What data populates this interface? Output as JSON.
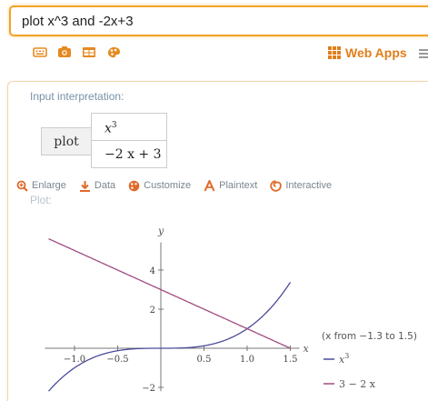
{
  "search": {
    "query": "plot x^3 and -2x+3"
  },
  "toolbar": {
    "icons": [
      "keyboard-icon",
      "camera-icon",
      "table-icon",
      "palette-icon"
    ],
    "web_apps_label": "Web Apps"
  },
  "interpretation": {
    "title": "Input interpretation:",
    "command": "plot",
    "f1_base": "x",
    "f1_exp": "3",
    "f2": "−2 x + 3"
  },
  "actions": {
    "enlarge": "Enlarge",
    "data": "Data",
    "customize": "Customize",
    "plaintext": "Plaintext",
    "interactive": "Interactive"
  },
  "plot_pod": {
    "title": "Plot:"
  },
  "colors": {
    "accent": "#f2a427",
    "series1": "#4b4b9c",
    "series2": "#a04a7f"
  },
  "chart_data": {
    "type": "line",
    "title": "",
    "xlabel": "x",
    "ylabel": "y",
    "xlim": [
      -1.3,
      1.5
    ],
    "ylim": [
      -2.2,
      5.6
    ],
    "x_ticks": [
      -1.0,
      -0.5,
      0.5,
      1.0,
      1.5
    ],
    "x_tick_labels": [
      "−1.0",
      "−0.5",
      "0.5",
      "1.0",
      "1.5"
    ],
    "y_ticks": [
      -2,
      2,
      4
    ],
    "y_tick_labels": [
      "−2",
      "2",
      "4"
    ],
    "range_note": "(x from −1.3 to 1.5)",
    "series": [
      {
        "name": "x",
        "superscript": "3",
        "color": "#4b4b9c",
        "formula": "cube"
      },
      {
        "name": "3 − 2 x",
        "superscript": "",
        "color": "#a04a7f",
        "formula": "linear"
      }
    ],
    "grid": false,
    "legend_position": "right"
  }
}
